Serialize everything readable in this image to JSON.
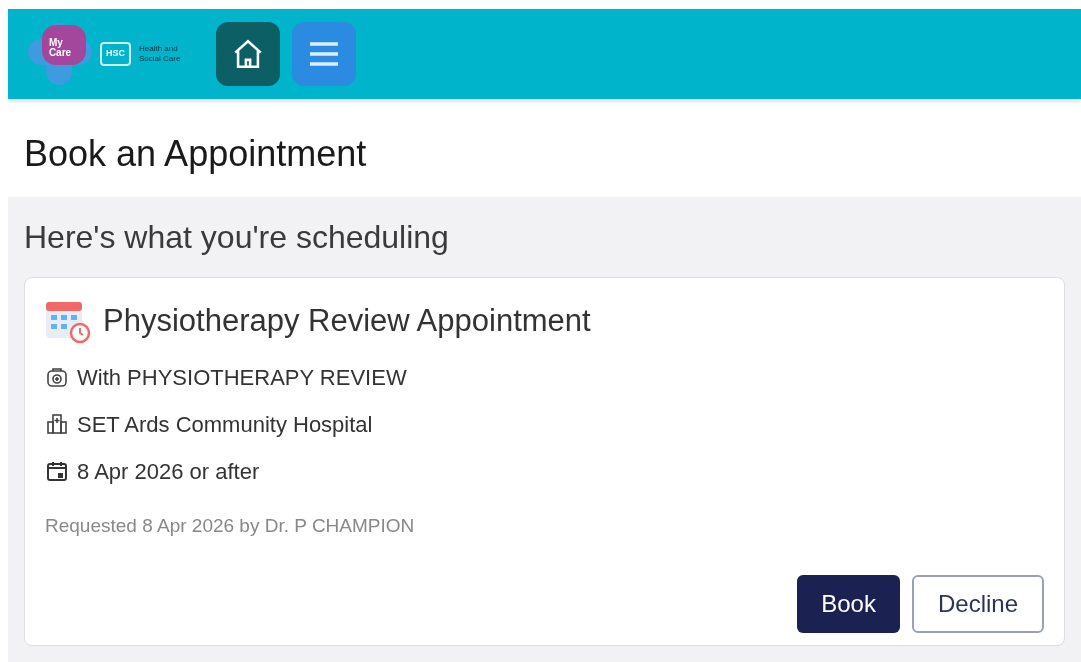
{
  "header": {
    "logo": {
      "mycare_line1": "My",
      "mycare_line2": "Care",
      "hsc": "HSC",
      "hsc_line1": "Health and",
      "hsc_line2": "Social Care"
    }
  },
  "page_title": "Book an Appointment",
  "section_title": "Here's what you're scheduling",
  "appointment": {
    "title": "Physiotherapy Review Appointment",
    "details": [
      {
        "kind": "clinician",
        "text": "With PHYSIOTHERAPY REVIEW"
      },
      {
        "kind": "location",
        "text": "SET Ards Community Hospital"
      },
      {
        "kind": "date",
        "text": "8 Apr 2026 or after"
      }
    ],
    "requested": "Requested 8 Apr 2026 by Dr. P CHAMPION",
    "actions": [
      {
        "kind": "primary",
        "label": "Book"
      },
      {
        "kind": "secondary",
        "label": "Decline"
      }
    ]
  }
}
